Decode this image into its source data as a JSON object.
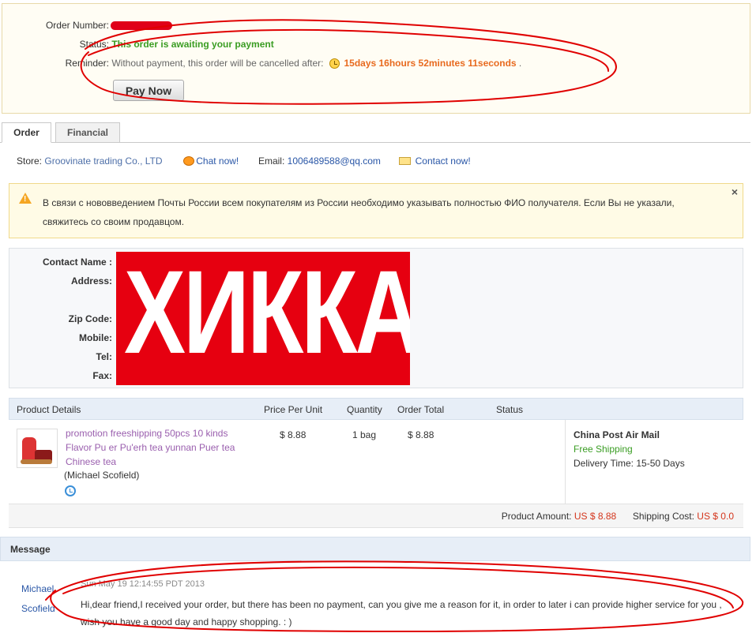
{
  "order_summary": {
    "order_number_label": "Order Number:",
    "status_label": "Status:",
    "status_text": "This order is awaiting your payment",
    "reminder_label": "Reminder:",
    "reminder_text": "Without payment, this order will be cancelled after:",
    "countdown": "15days 16hours 52minutes 11seconds",
    "countdown_suffix": ".",
    "pay_button": "Pay Now"
  },
  "tabs": [
    {
      "label": "Order",
      "active": true
    },
    {
      "label": "Financial",
      "active": false
    }
  ],
  "store": {
    "store_label": "Store:",
    "store_name": "Groovinate trading Co., LTD",
    "chat_label": "Chat now!",
    "email_label": "Email:",
    "email": "1006489588@qq.com",
    "contact_label": "Contact now!"
  },
  "notice": {
    "text": "В связи с нововведением Почты России всем покупателям из России необходимо указывать полностью ФИО получателя. Если Вы не указали, свяжитесь со своим продавцом.",
    "close": "×"
  },
  "address": {
    "contact_name_label": "Contact Name :",
    "address_label": "Address:",
    "zip_label": "Zip Code:",
    "mobile_label": "Mobile:",
    "tel_label": "Tel:",
    "fax_label": "Fax:",
    "censor_text": "ХИККА"
  },
  "products": {
    "headers": [
      "Product Details",
      "Price Per Unit",
      "Quantity",
      "Order Total",
      "Status"
    ],
    "rows": [
      {
        "name": "promotion freeshipping 50pcs 10 kinds Flavor Pu er Pu'erh tea yunnan Puer tea Chinese tea",
        "buyer": "(Michael Scofield)",
        "price": "$ 8.88",
        "quantity": "1 bag",
        "total": "$ 8.88",
        "status": ""
      }
    ],
    "shipping": {
      "method": "China Post Air Mail",
      "cost_text": "Free Shipping",
      "delivery_label": "Delivery Time:",
      "delivery_time": "15-50 Days"
    },
    "totals": {
      "product_amount_label": "Product Amount:",
      "product_amount": "US $ 8.88",
      "shipping_cost_label": "Shipping Cost:",
      "shipping_cost": "US $ 0.0"
    }
  },
  "message": {
    "header": "Message",
    "sender_first": "Michael",
    "sender_last": "Scofield",
    "date": "Sun May 19 12:14:55 PDT 2013",
    "text": "Hi,dear friend,I received your order, but there has been no payment, can you give me a reason for it, in order to later i can provide higher service for you , wish you have a good day and happy shopping. : )"
  },
  "colors": {
    "status_green": "#3a9d23",
    "countdown_orange": "#e86a1f",
    "link_blue": "#2a57a7",
    "product_purple": "#9a5fae",
    "money_red": "#d4351c",
    "annotation_red": "#e00000",
    "censor_red": "#e60010"
  },
  "icons": [
    "clock-icon",
    "chat-icon",
    "mail-icon",
    "warning-icon",
    "close-icon",
    "alarm-icon"
  ]
}
